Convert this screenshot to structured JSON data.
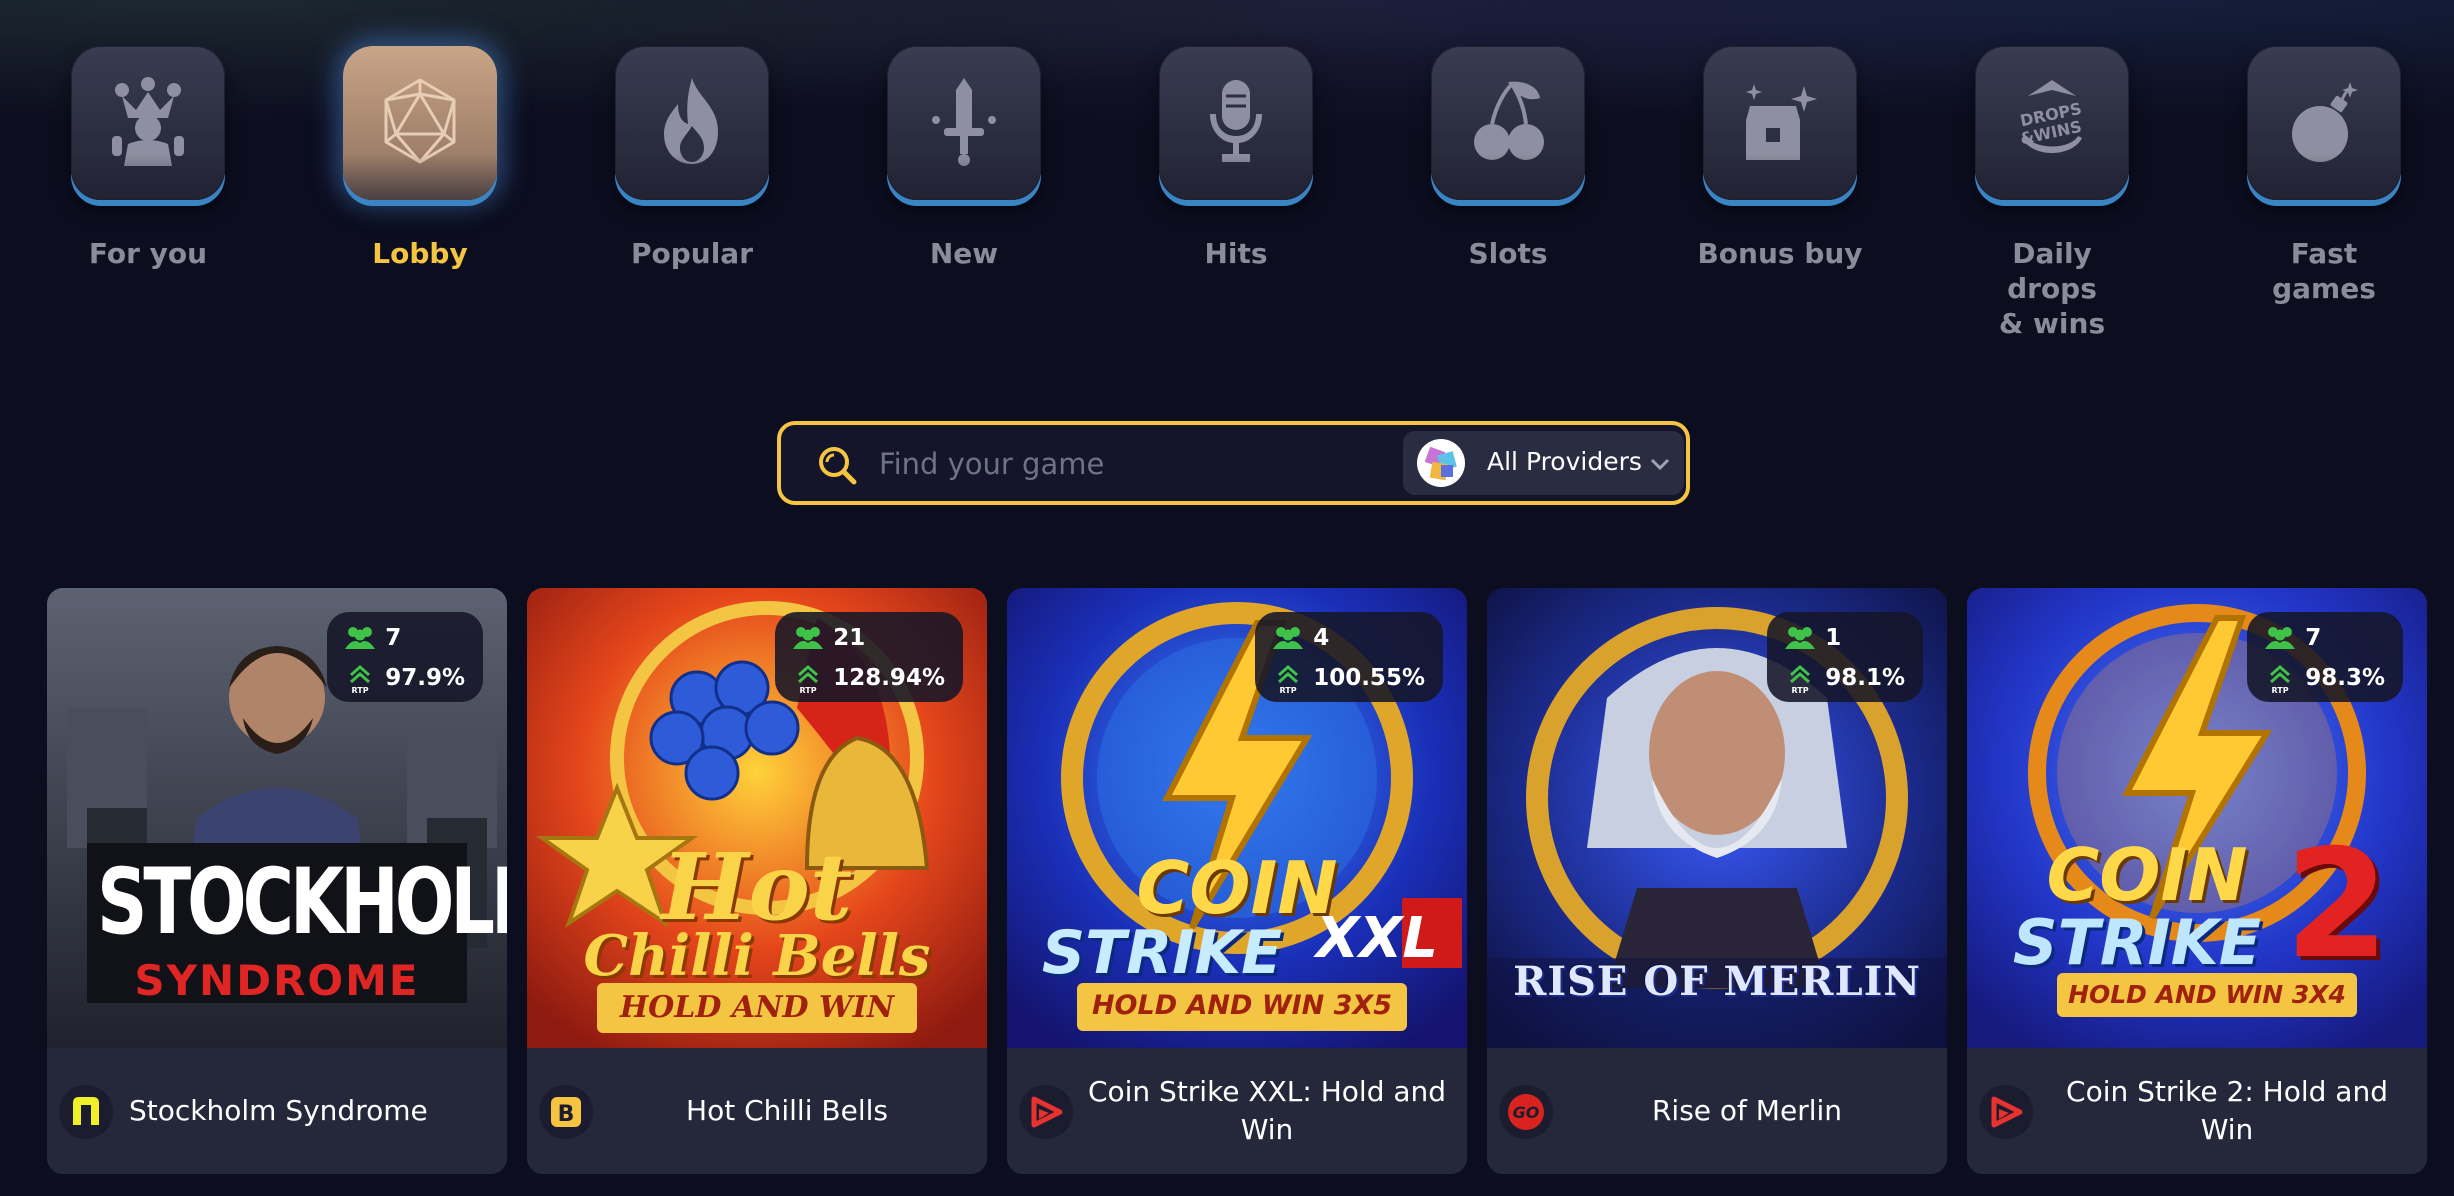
{
  "categories": [
    {
      "label": "For you",
      "icon": "jester-icon",
      "active": false
    },
    {
      "label": "Lobby",
      "icon": "dice-icon",
      "active": true
    },
    {
      "label": "Popular",
      "icon": "flame-icon",
      "active": false
    },
    {
      "label": "New",
      "icon": "sword-icon",
      "active": false
    },
    {
      "label": "Hits",
      "icon": "microphone-icon",
      "active": false
    },
    {
      "label": "Slots",
      "icon": "cherries-icon",
      "active": false
    },
    {
      "label": "Bonus buy",
      "icon": "treasure-chest-icon",
      "active": false
    },
    {
      "label": "Daily drops & wins",
      "icon": "drops-wins-icon",
      "badge_text": "DROPS &WINS",
      "active": false
    },
    {
      "label": "Fast games",
      "icon": "bomb-icon",
      "active": false
    }
  ],
  "search": {
    "placeholder": "Find your game",
    "value": "",
    "provider_label": "All Providers"
  },
  "games": [
    {
      "title": "Stockholm Syndrome",
      "players": "7",
      "rtp": "97.9%",
      "rtp_label": "RTP",
      "provider_icon": "nolimit-logo-icon",
      "art_title": "STOCKHOLM",
      "art_subtitle": "SYNDROME"
    },
    {
      "title": "Hot Chilli Bells",
      "players": "21",
      "rtp": "128.94%",
      "rtp_label": "RTP",
      "provider_icon": "bgaming-logo-icon",
      "art_title": "Hot",
      "art_subtitle": "Chilli Bells",
      "art_tag": "HOLD AND WIN"
    },
    {
      "title": "Coin Strike XXL: Hold and Win",
      "players": "4",
      "rtp": "100.55%",
      "rtp_label": "RTP",
      "provider_icon": "playson-logo-icon",
      "art_title": "COIN",
      "art_subtitle": "STRIKE",
      "art_badge": "XXL",
      "art_tag": "HOLD AND WIN 3X5"
    },
    {
      "title": "Rise of Merlin",
      "players": "1",
      "rtp": "98.1%",
      "rtp_label": "RTP",
      "provider_icon": "playngo-logo-icon",
      "provider_text": "GO",
      "art_title": "RISE OF MERLIN"
    },
    {
      "title": "Coin Strike 2: Hold and Win",
      "players": "7",
      "rtp": "98.3%",
      "rtp_label": "RTP",
      "provider_icon": "playson-logo-icon",
      "art_title": "COIN",
      "art_subtitle": "STRIKE",
      "art_badge": "2",
      "art_tag": "HOLD AND WIN 3X4"
    }
  ],
  "colors": {
    "background": "#0c0d1f",
    "accent": "#f5c542",
    "tile": "#2e3044",
    "tile_active": "#b89479",
    "tile_border": "#3a86c5",
    "label": "#8a8c9c",
    "players_icon": "#3ec24a",
    "card_footer": "#25273a"
  }
}
